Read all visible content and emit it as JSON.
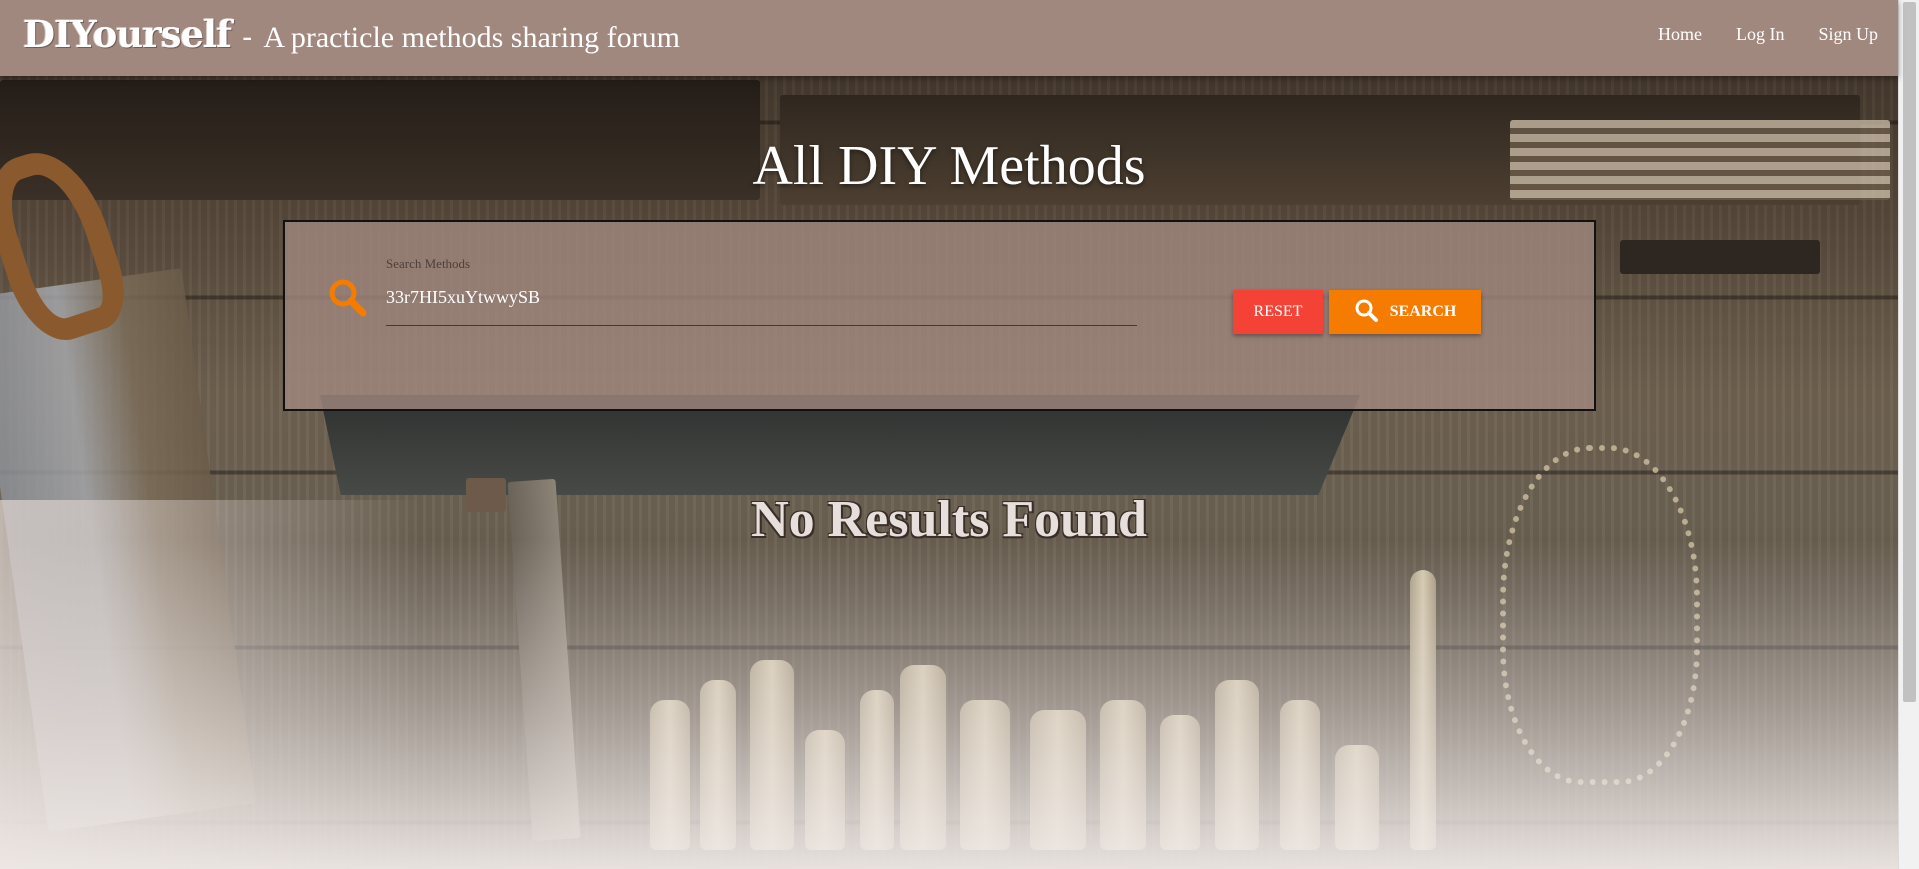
{
  "navbar": {
    "brand_logo": "DIYourself",
    "brand_separator": "-",
    "brand_tagline": "A practicle methods sharing forum",
    "links": [
      {
        "label": "Home"
      },
      {
        "label": "Log In"
      },
      {
        "label": "Sign Up"
      }
    ]
  },
  "main": {
    "title": "All DIY Methods",
    "search": {
      "label": "Search Methods",
      "value": "33r7HI5xuYtwwySB",
      "icon": "search-icon",
      "reset_label": "RESET",
      "search_label": "SEARCH"
    },
    "empty_message": "No Results Found"
  },
  "colors": {
    "navbar": "#a1887f",
    "panel": "#a1887f",
    "reset_button": "#f44336",
    "search_button": "#f57c00",
    "search_icon": "#f57c00",
    "input_underline": "#1e4d2b"
  }
}
